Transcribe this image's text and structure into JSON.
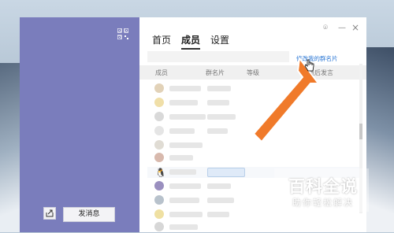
{
  "left_panel": {
    "icons": {
      "qr": "qr-code-icon",
      "share": "share-icon"
    },
    "send_message_label": "发消息"
  },
  "window": {
    "pin": "⌾",
    "minimize": "—",
    "close": "×"
  },
  "tabs": [
    {
      "label": "首页",
      "active": false
    },
    {
      "label": "成员",
      "active": true
    },
    {
      "label": "设置",
      "active": false
    }
  ],
  "edit_card_link": "修改我的群名片",
  "table": {
    "headers": [
      "成员",
      "群名片",
      "等级",
      "最后发言"
    ]
  },
  "watermark": {
    "title": "百科全说",
    "subtitle": "助你轻松解决"
  },
  "colors": {
    "sidebar": "#7a7dbc",
    "arrow": "#f07a2a",
    "link": "#2f7ad6"
  }
}
